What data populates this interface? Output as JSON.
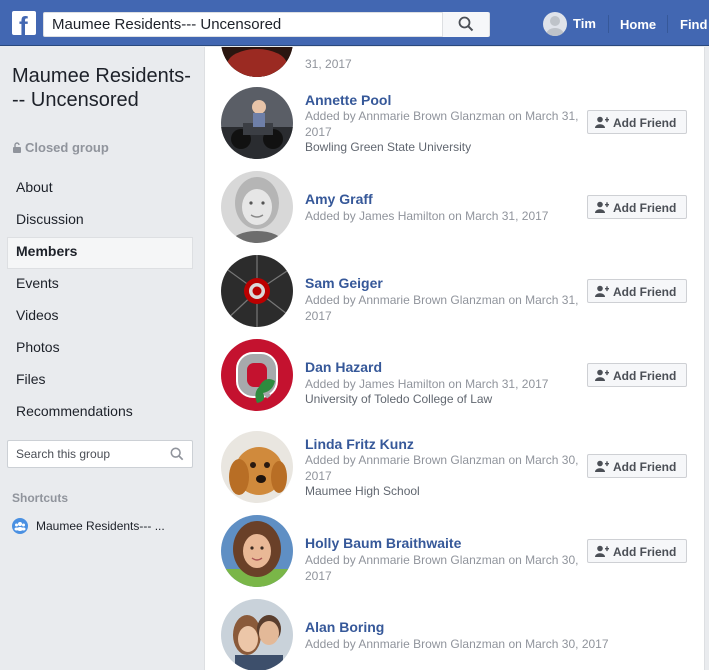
{
  "topbar": {
    "logo": "f",
    "search_value": "Maumee Residents--- Uncensored",
    "search_icon": "search-icon",
    "user_name": "Tim",
    "home_label": "Home",
    "find_label": "Find"
  },
  "sidebar": {
    "group_name": "Maumee Residents--- Uncensored",
    "privacy_label": "Closed group",
    "items": [
      {
        "label": "About"
      },
      {
        "label": "Discussion"
      },
      {
        "label": "Members"
      },
      {
        "label": "Events"
      },
      {
        "label": "Videos"
      },
      {
        "label": "Photos"
      },
      {
        "label": "Files"
      },
      {
        "label": "Recommendations"
      }
    ],
    "search_placeholder": "Search this group",
    "shortcuts_label": "Shortcuts",
    "shortcut_item": "Maumee Residents--- ..."
  },
  "members": {
    "add_friend_label": "Add Friend",
    "partial_top_line": "31, 2017",
    "list": [
      {
        "name": "Annette Pool",
        "added": "Added by Annmarie Brown Glanzman on March 31, 2017",
        "extra": "Bowling Green State University"
      },
      {
        "name": "Amy Graff",
        "added": "Added by James Hamilton on March 31, 2017",
        "extra": ""
      },
      {
        "name": "Sam Geiger",
        "added": "Added by Annmarie Brown Glanzman on March 31, 2017",
        "extra": ""
      },
      {
        "name": "Dan Hazard",
        "added": "Added by James Hamilton on March 31, 2017",
        "extra": "University of Toledo College of Law"
      },
      {
        "name": "Linda Fritz Kunz",
        "added": "Added by Annmarie Brown Glanzman on March 30, 2017",
        "extra": "Maumee High School"
      },
      {
        "name": "Holly Baum Braithwaite",
        "added": "Added by Annmarie Brown Glanzman on March 30, 2017",
        "extra": ""
      },
      {
        "name": "Alan Boring",
        "added": "Added by Annmarie Brown Glanzman on March 30, 2017",
        "extra": ""
      }
    ]
  }
}
